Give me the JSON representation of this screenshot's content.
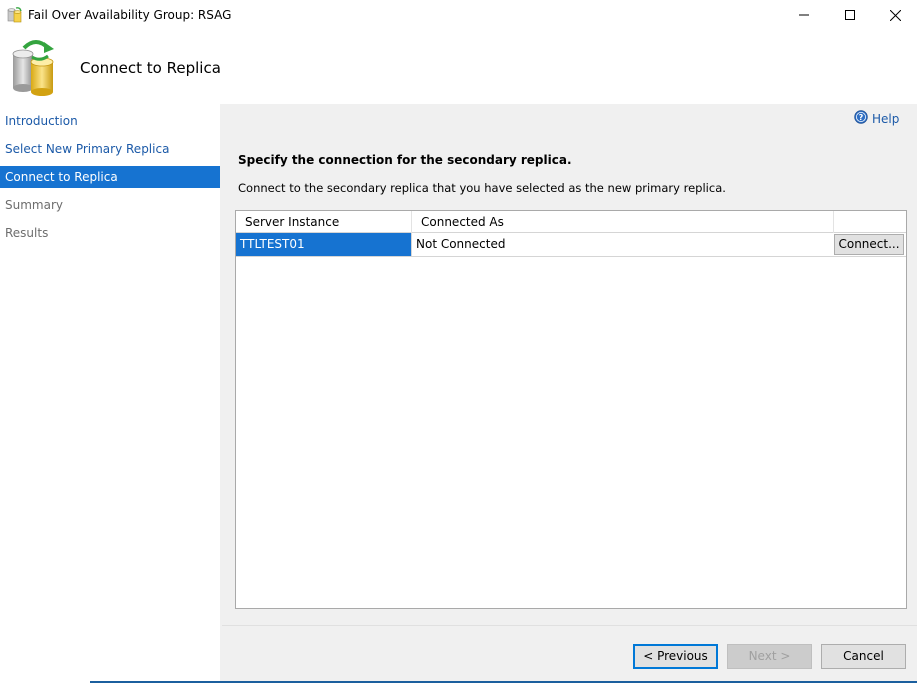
{
  "window": {
    "title": "Fail Over Availability Group: RSAG",
    "icons": {
      "app": "database-cylinder-icon",
      "minimize": "minimize-icon",
      "maximize": "maximize-icon",
      "close": "close-icon"
    }
  },
  "header": {
    "title": "Connect to Replica",
    "icon": "database-failover-icon"
  },
  "nav": {
    "items": [
      {
        "label": "Introduction",
        "state": "link"
      },
      {
        "label": "Select New Primary Replica",
        "state": "link"
      },
      {
        "label": "Connect to Replica",
        "state": "selected"
      },
      {
        "label": "Summary",
        "state": "disabled"
      },
      {
        "label": "Results",
        "state": "disabled"
      }
    ]
  },
  "content": {
    "help_label": "Help",
    "heading": "Specify the connection for the secondary replica.",
    "description": "Connect to the secondary replica that you have selected as the new primary replica.",
    "grid": {
      "columns": [
        "Server Instance",
        "Connected As",
        ""
      ],
      "rows": [
        {
          "server_instance": "TTLTEST01",
          "connected_as": "Not Connected",
          "action_label": "Connect..."
        }
      ]
    }
  },
  "footer": {
    "previous_label": "< Previous",
    "next_label": "Next >",
    "cancel_label": "Cancel"
  },
  "colors": {
    "selection": "#1673d1",
    "link": "#1c5aa8",
    "panel": "#f0f0f0"
  }
}
